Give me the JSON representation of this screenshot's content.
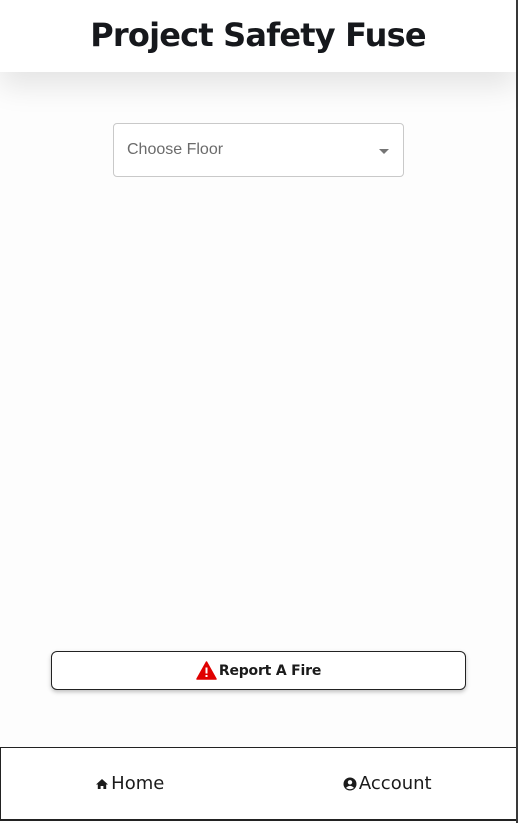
{
  "header": {
    "title": "Project Safety Fuse"
  },
  "floor_select": {
    "placeholder": "Choose Floor",
    "caret_icon": "caret-down-icon"
  },
  "report_button": {
    "label": "Report A Fire",
    "icon": "warning-icon",
    "icon_color": "#e00000"
  },
  "bottom_nav": {
    "items": [
      {
        "label": "Home",
        "icon": "home-icon"
      },
      {
        "label": "Account",
        "icon": "account-circle-icon"
      }
    ]
  }
}
